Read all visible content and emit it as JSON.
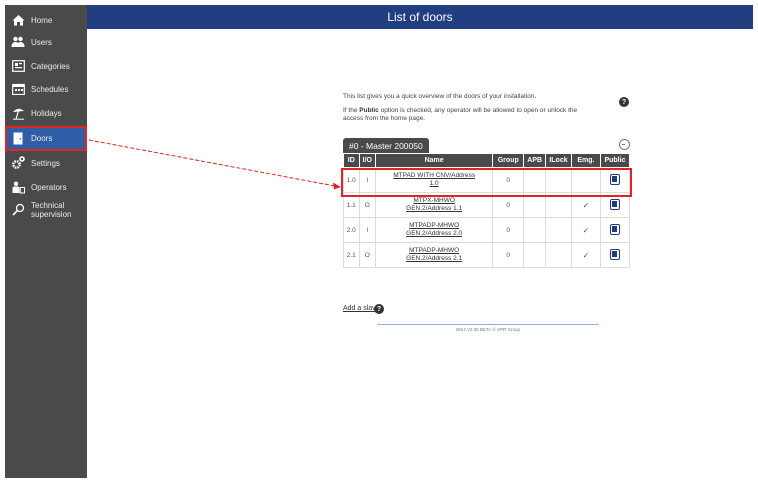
{
  "header": {
    "title": "List of doors"
  },
  "sidebar": {
    "items": [
      {
        "label": "Home",
        "icon": "home-icon"
      },
      {
        "label": "Users",
        "icon": "users-icon"
      },
      {
        "label": "Categories",
        "icon": "categories-icon"
      },
      {
        "label": "Schedules",
        "icon": "calendar-icon"
      },
      {
        "label": "Holidays",
        "icon": "beach-icon"
      },
      {
        "label": "Doors",
        "icon": "door-icon",
        "active": true
      },
      {
        "label": "Settings",
        "icon": "gear-icon"
      },
      {
        "label": "Operators",
        "icon": "operator-icon"
      },
      {
        "label": "Technical\nsupervision",
        "icon": "wrench-icon"
      }
    ]
  },
  "intro": {
    "line1": "This list gives you a quick overview of the doors of your installation.",
    "line2_prefix": "If the ",
    "line2_bold": "Public",
    "line2_suffix": " option is checked, any operator will be allowed to open or unlock the",
    "line3": "access from the home page."
  },
  "master": {
    "label": "#0 - Master 200050"
  },
  "table": {
    "columns": [
      "ID",
      "I/O",
      "Name",
      "Group",
      "APB",
      "ILock",
      "Emg.",
      "Public"
    ],
    "rows": [
      {
        "id": "1.0",
        "io": "I",
        "name_line1": "MTPAD WITH CNV/Address",
        "name_line2": "1.0",
        "group": "0",
        "apb": "",
        "ilock": "",
        "emg": "",
        "public": true
      },
      {
        "id": "1.1",
        "io": "O",
        "name_line1": "MTPX-MHWO",
        "name_line2": "GEN.2/Address 1.1",
        "group": "0",
        "apb": "",
        "ilock": "",
        "emg": "✓",
        "public": true
      },
      {
        "id": "2.0",
        "io": "I",
        "name_line1": "MTPADP-MHWO",
        "name_line2": "GEN.2/Address 2.0",
        "group": "0",
        "apb": "",
        "ilock": "",
        "emg": "✓",
        "public": true
      },
      {
        "id": "2.1",
        "io": "O",
        "name_line1": "MTPADP-MHWO",
        "name_line2": "GEN.2/Address 2.1",
        "group": "0",
        "apb": "",
        "ilock": "",
        "emg": "✓",
        "public": true
      }
    ]
  },
  "add_slave": "Add a slave",
  "footer": "WS4 V2.55 BETA © XPR Group",
  "colors": {
    "header": "#213e80",
    "sidebar": "#4a4a4a",
    "active": "#2f5ea6",
    "annotation": "#e02525"
  }
}
